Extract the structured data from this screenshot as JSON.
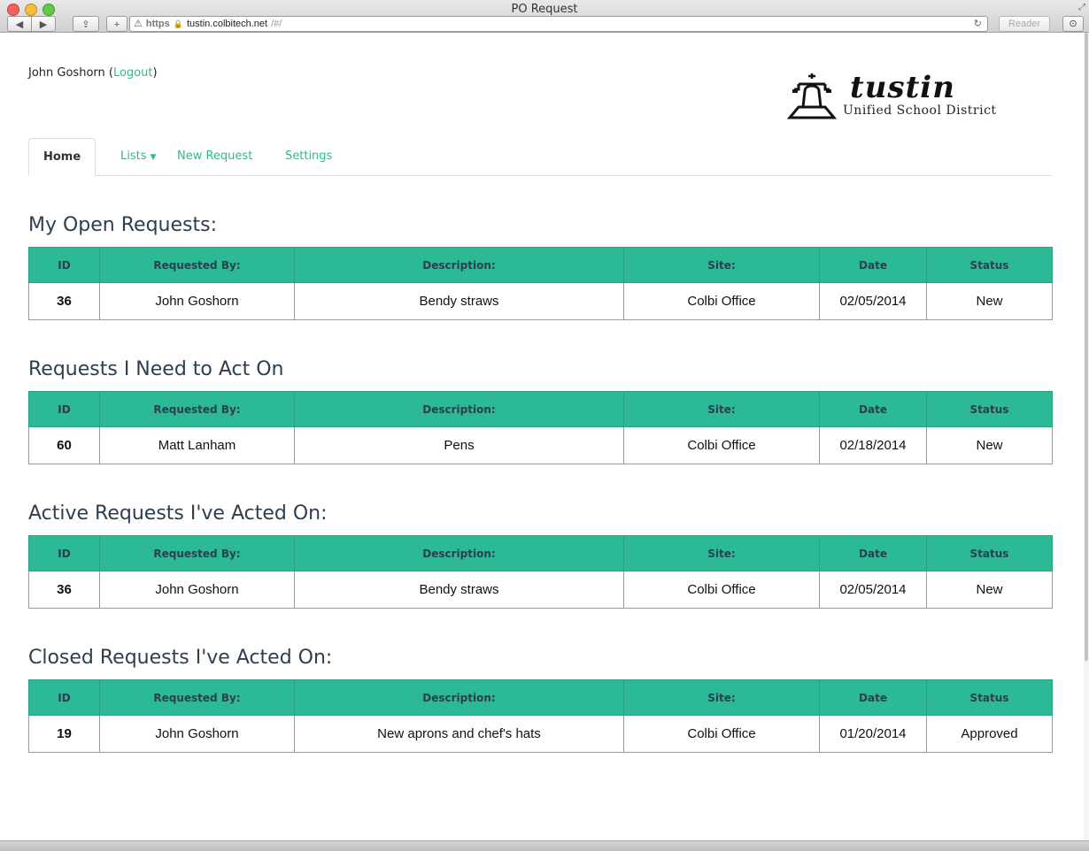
{
  "window": {
    "title": "PO Request",
    "url_scheme": "https",
    "url_host": "tustin.colbitech.net",
    "url_path": "/#/",
    "reader_label": "Reader"
  },
  "header": {
    "user_name": "John Goshorn",
    "logout_label": "Logout",
    "logo_main": "tustin",
    "logo_sub": "Unified School District"
  },
  "tabs": {
    "home": "Home",
    "lists": "Lists",
    "new_request": "New Request",
    "settings": "Settings"
  },
  "columns": [
    "ID",
    "Requested By:",
    "Description:",
    "Site:",
    "Date",
    "Status"
  ],
  "sections": [
    {
      "title": "My Open Requests:",
      "rows": [
        {
          "id": "36",
          "requested_by": "John Goshorn",
          "description": "Bendy straws",
          "site": "Colbi Office",
          "date": "02/05/2014",
          "status": "New"
        }
      ]
    },
    {
      "title": "Requests I Need to Act On",
      "rows": [
        {
          "id": "60",
          "requested_by": "Matt Lanham",
          "description": "Pens",
          "site": "Colbi Office",
          "date": "02/18/2014",
          "status": "New"
        }
      ]
    },
    {
      "title": "Active Requests I've Acted On:",
      "rows": [
        {
          "id": "36",
          "requested_by": "John Goshorn",
          "description": "Bendy straws",
          "site": "Colbi Office",
          "date": "02/05/2014",
          "status": "New"
        }
      ]
    },
    {
      "title": "Closed Requests I've Acted On:",
      "rows": [
        {
          "id": "19",
          "requested_by": "John Goshorn",
          "description": "New aprons and chef's hats",
          "site": "Colbi Office",
          "date": "01/20/2014",
          "status": "Approved"
        }
      ]
    }
  ],
  "colors": {
    "accent": "#2bb996",
    "heading": "#2c3e50"
  }
}
